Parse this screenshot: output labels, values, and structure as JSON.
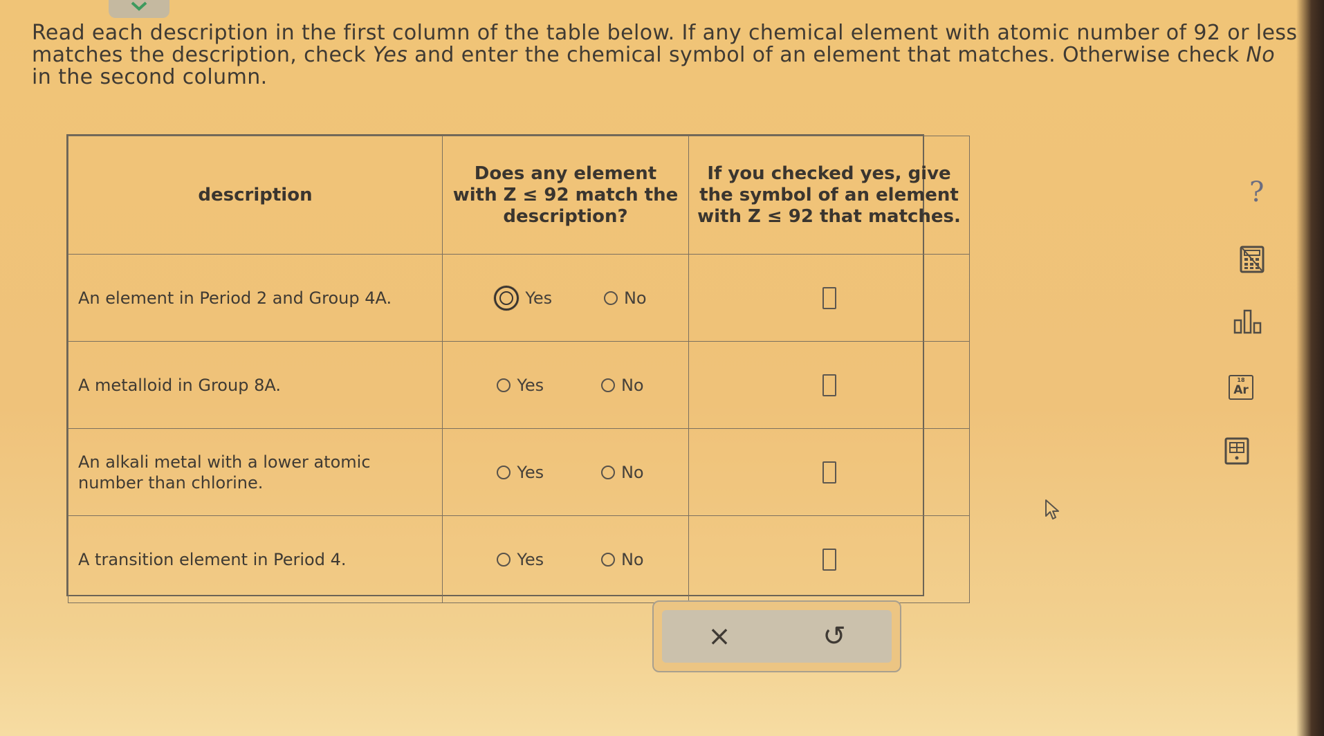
{
  "instructions": {
    "part1": "Read each description in the first column of the table below. If any chemical element with atomic number of 92 or less matches the description, check ",
    "yes_word": "Yes",
    "part2": " and enter the chemical symbol of an element that matches. Otherwise check ",
    "no_word": "No",
    "part3": " in the second column."
  },
  "table": {
    "headers": {
      "description": "description",
      "match": "Does any element with Z ≤ 92 match the description?",
      "symbol": "If you checked yes, give the symbol of an element with Z ≤ 92 that matches."
    },
    "rows": [
      {
        "description": "An element in Period 2 and Group 4A.",
        "yes_label": "Yes",
        "no_label": "No",
        "selected": "yes",
        "symbol_value": ""
      },
      {
        "description": "A metalloid in Group 8A.",
        "yes_label": "Yes",
        "no_label": "No",
        "selected": "",
        "symbol_value": ""
      },
      {
        "description": "An alkali metal with a lower atomic number than chlorine.",
        "yes_label": "Yes",
        "no_label": "No",
        "selected": "",
        "symbol_value": ""
      },
      {
        "description": "A transition element in Period 4.",
        "yes_label": "Yes",
        "no_label": "No",
        "selected": "",
        "symbol_value": ""
      }
    ]
  },
  "actions": {
    "clear_symbol": "×",
    "undo_symbol": "↺"
  },
  "tools": {
    "help": "?",
    "periodic_symbol": "Ar",
    "periodic_number": "18"
  },
  "icons": {
    "check": "check-icon",
    "help": "help-icon",
    "calculator": "calculator-icon",
    "chart": "bar-chart-icon",
    "periodic": "periodic-table-icon",
    "data": "data-reference-icon",
    "cursor": "mouse-cursor-icon"
  },
  "colors": {
    "background": "#efc27a",
    "border": "#7b705f",
    "text": "#3f3a33",
    "action_bar": "#cbc1ac",
    "check_tab": "#4aa36b"
  }
}
